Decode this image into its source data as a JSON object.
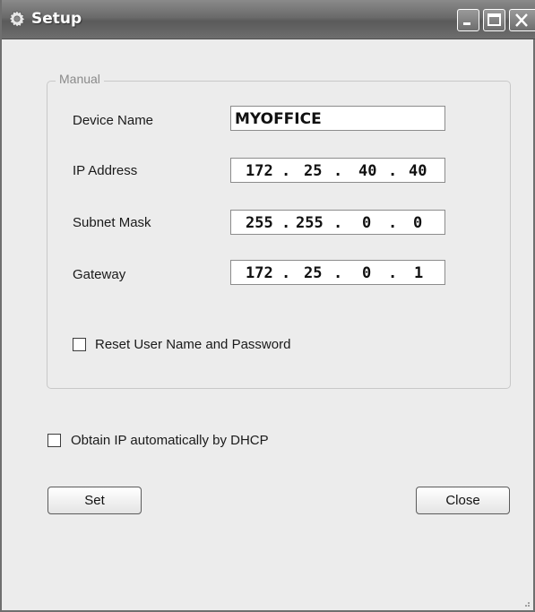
{
  "window": {
    "title": "Setup",
    "icon": "gear-icon",
    "controls": [
      "minimize-icon",
      "maximize-icon",
      "close-icon"
    ]
  },
  "manual_group": {
    "legend": "Manual",
    "device_name": {
      "label": "Device Name",
      "value": "MYOFFICE"
    },
    "ip_address": {
      "label": "IP Address",
      "octets": [
        "172",
        "25",
        "40",
        "40"
      ]
    },
    "subnet_mask": {
      "label": "Subnet Mask",
      "octets": [
        "255",
        "255",
        "0",
        "0"
      ]
    },
    "gateway": {
      "label": "Gateway",
      "octets": [
        "172",
        "25",
        "0",
        "1"
      ]
    },
    "ip_separator": ".",
    "reset_checkbox": {
      "label": "Reset User Name and Password",
      "checked": false
    }
  },
  "dhcp_checkbox": {
    "label": "Obtain IP automatically by DHCP",
    "checked": false
  },
  "buttons": {
    "set_label": "Set",
    "close_label": "Close"
  }
}
